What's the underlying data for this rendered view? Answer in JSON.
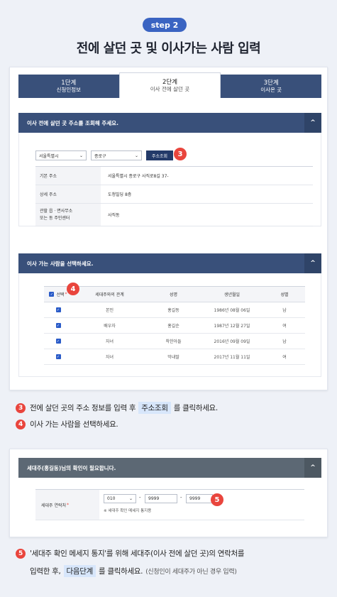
{
  "step_badge": "step 2",
  "main_title": "전에 살던 곳 및 이사가는 사람 입력",
  "tabs": [
    {
      "line1": "1단계",
      "line2": "신청인정보",
      "active": false
    },
    {
      "line1": "2단계",
      "line2": "이사 전에 살던 곳",
      "active": true
    },
    {
      "line1": "3단계",
      "line2": "이사온 곳",
      "active": false
    }
  ],
  "section1": {
    "title": "이사 전에 살던 곳 주소를 조회해 주세요.",
    "toggle_icon": "^",
    "city_select": "서울특별시",
    "district_select": "종로구",
    "search_button": "주소조회",
    "badge": "3",
    "rows": [
      {
        "label": "기본 주소",
        "value": "서울특별시 종로구 사직로8길 37-"
      },
      {
        "label": "상세 주소",
        "value": "도청빌딩 8층"
      },
      {
        "label": "관할 읍 · 면사무소\n또는 동 주민센터",
        "value": "사직동"
      }
    ]
  },
  "section2": {
    "title": "이사 가는 사람을 선택하세요.",
    "toggle_icon": "^",
    "badge": "4",
    "headers": [
      "선택",
      "세대주와의 관계",
      "성명",
      "생년월일",
      "성별"
    ],
    "rows": [
      {
        "relation": "본인",
        "name": "홍길동",
        "birth": "1986년 08월 06일",
        "gender": "남"
      },
      {
        "relation": "배우자",
        "name": "홍길순",
        "birth": "1987년 12월 27일",
        "gender": "여"
      },
      {
        "relation": "자녀",
        "name": "착한아들",
        "birth": "2016년 09월 09일",
        "gender": "남"
      },
      {
        "relation": "자녀",
        "name": "막내딸",
        "birth": "2017년 11월 11일",
        "gender": "여"
      }
    ]
  },
  "instructions1": [
    {
      "num": "3",
      "before": "전에 살던 곳의 주소 정보를 입력 후",
      "highlight": "주소조회",
      "after": "를 클릭하세요."
    },
    {
      "num": "4",
      "before": "이사 가는 사람을 선택하세요.",
      "highlight": "",
      "after": ""
    }
  ],
  "section3": {
    "title": "세대주(홍길동)님의 확인이 필요합니다.",
    "toggle_icon": "^",
    "label": "세대주 연락처",
    "phone1": "010",
    "phone2": "9999",
    "phone3": "9999",
    "note": "※ 세대주 확인 메세지 통지용",
    "badge": "5"
  },
  "instruction5": {
    "num": "5",
    "line1": "'세대주 확인 메세지 통지'를 위해 세대주(이사 전에 살던 곳)의 연락처를",
    "line2_before": "입력한 후,",
    "highlight": "다음단계",
    "line2_after": "를 클릭하세요.",
    "muted": "(신청인이 세대주가 아닌 경우 입력)"
  },
  "colors": {
    "accent": "#3a64c2",
    "navy": "#39507a",
    "badge_red": "#e9453d",
    "highlight": "#d7e6fb"
  }
}
